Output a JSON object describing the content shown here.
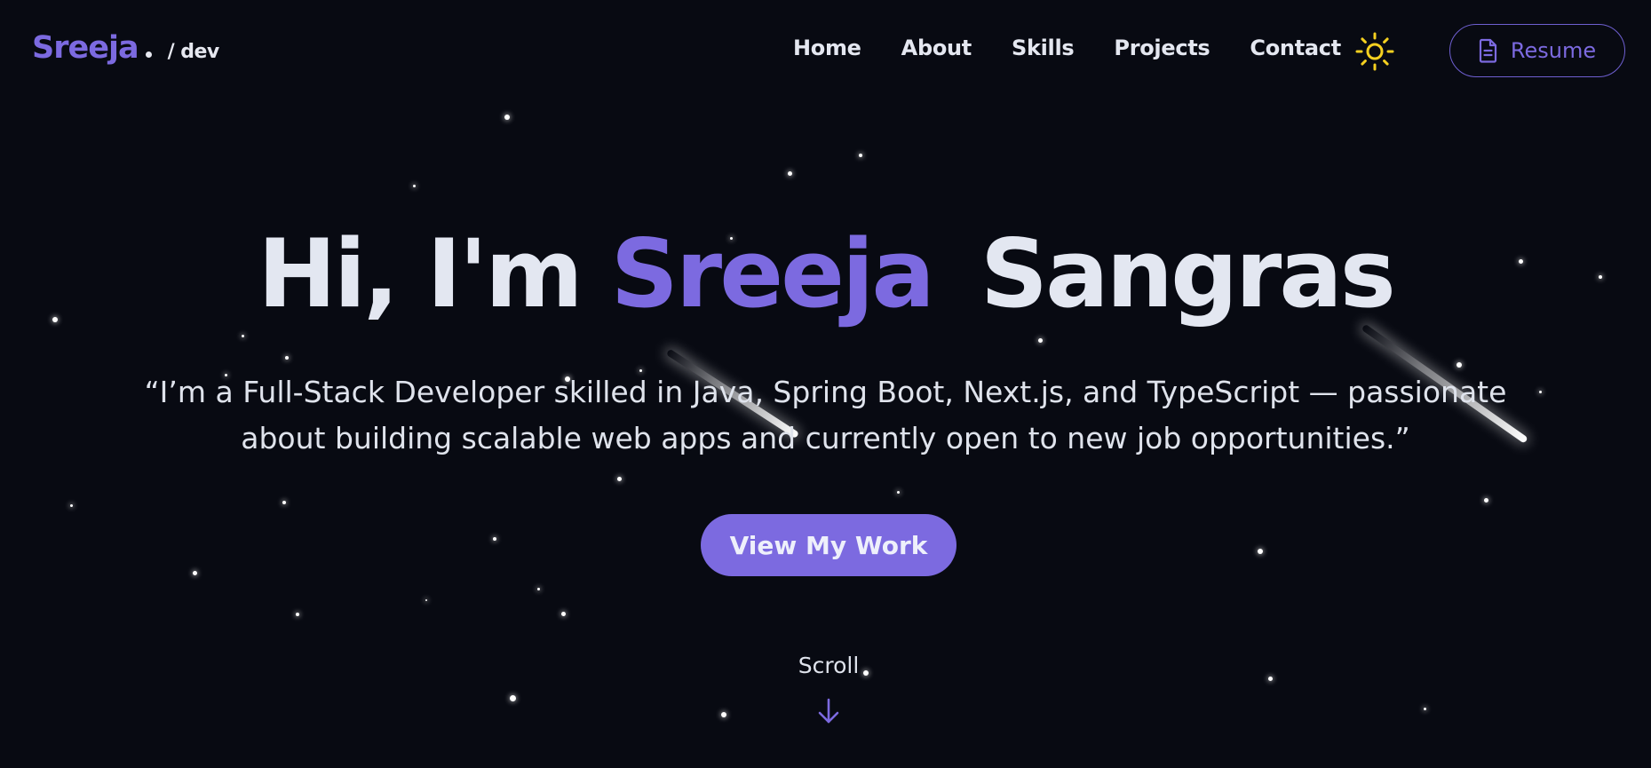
{
  "brand": {
    "name": "Sreeja",
    "suffix": "/ dev"
  },
  "nav": {
    "links": [
      "Home",
      "About",
      "Skills",
      "Projects",
      "Contact"
    ],
    "theme_toggle_icon": "sun-icon",
    "resume_label": "Resume",
    "resume_icon": "document-icon"
  },
  "hero": {
    "greeting": "Hi, I'm",
    "first_name": "Sreeja",
    "last_name": "Sangras",
    "quote": "“I’m a Full-Stack Developer skilled in Java, Spring Boot, Next.js, and TypeScript — passionate about building scalable web apps and currently open to new job opportunities.”",
    "cta_label": "View My Work"
  },
  "scroll": {
    "label": "Scroll",
    "icon": "arrow-down-icon"
  },
  "colors": {
    "background": "#080a12",
    "accent": "#7c6ae0",
    "text": "#e3e7f1",
    "sun": "#f5d020"
  }
}
